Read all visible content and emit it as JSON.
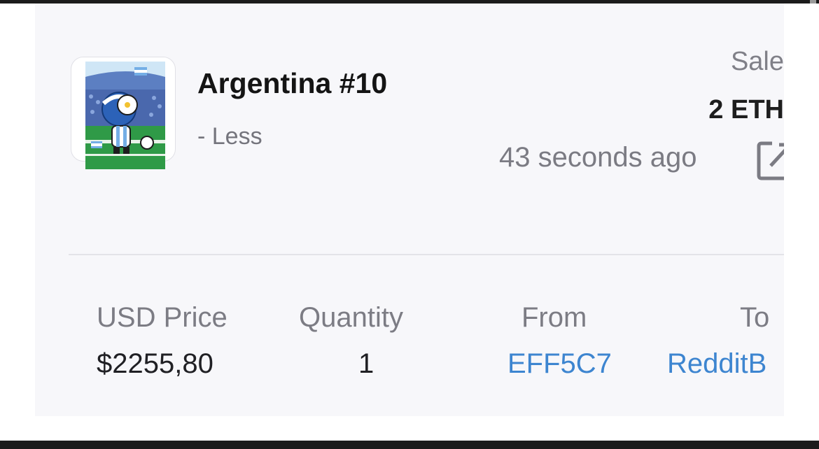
{
  "item": {
    "name": "Argentina #10",
    "toggle_label": "- Less",
    "thumbnail_icon": "argentina-avatar-nft-image"
  },
  "transaction": {
    "event": "Sale",
    "price": "2 ETH",
    "time_ago": "43 seconds ago",
    "external_link_icon": "external-link-icon"
  },
  "details": {
    "usd_price_label": "USD Price",
    "usd_price_value": "$2255,80",
    "quantity_label": "Quantity",
    "quantity_value": "1",
    "from_label": "From",
    "from_value": "EFF5C7",
    "to_label": "To",
    "to_value": "RedditB"
  },
  "colors": {
    "link": "#3d85d0",
    "card_background": "#f7f7fa",
    "frame": "#1b1b1b"
  }
}
